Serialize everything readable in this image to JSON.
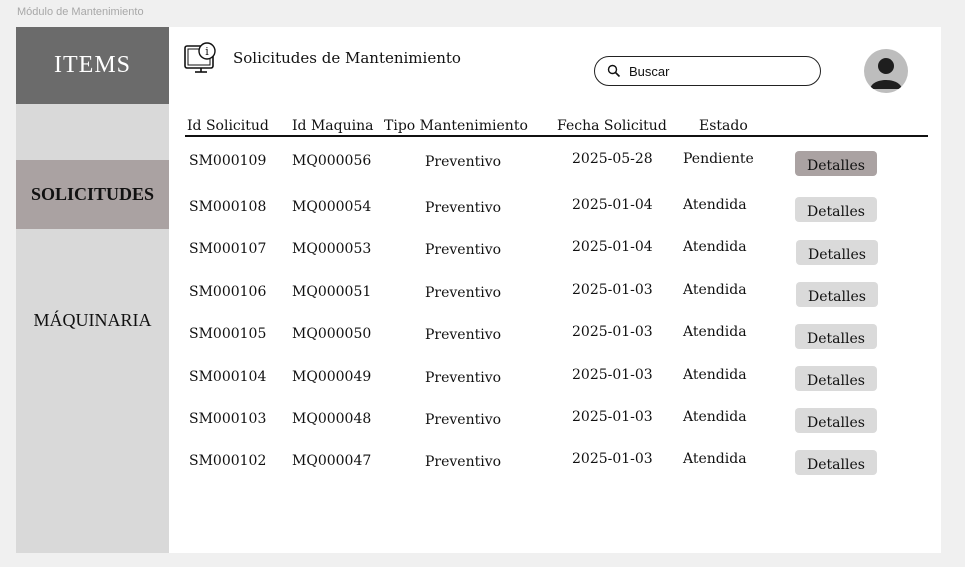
{
  "frame_label": "Módulo de Mantenimiento",
  "sidebar": {
    "logo": "ITEMS",
    "items": [
      {
        "label": "SOLICITUDES",
        "active": true
      },
      {
        "label": "MÁQUINARIA",
        "active": false
      }
    ]
  },
  "header": {
    "title": "Solicitudes de Mantenimiento",
    "title_icon": "computer-info-icon",
    "search_placeholder": "Buscar",
    "avatar_icon": "user-avatar-icon"
  },
  "table": {
    "columns": [
      "Id Solicitud",
      "Id Maquina",
      "Tipo Mantenimiento",
      "Fecha Solicitud",
      "Estado"
    ],
    "action_label": "Detalles",
    "rows": [
      {
        "id": "SM000109",
        "maquina": "MQ000056",
        "tipo": "Preventivo",
        "fecha": "2025-05-28",
        "estado": "Pendiente"
      },
      {
        "id": "SM000108",
        "maquina": "MQ000054",
        "tipo": "Preventivo",
        "fecha": "2025-01-04",
        "estado": "Atendida"
      },
      {
        "id": "SM000107",
        "maquina": "MQ000053",
        "tipo": "Preventivo",
        "fecha": "2025-01-04",
        "estado": "Atendida"
      },
      {
        "id": "SM000106",
        "maquina": "MQ000051",
        "tipo": "Preventivo",
        "fecha": "2025-01-03",
        "estado": "Atendida"
      },
      {
        "id": "SM000105",
        "maquina": "MQ000050",
        "tipo": "Preventivo",
        "fecha": "2025-01-03",
        "estado": "Atendida"
      },
      {
        "id": "SM000104",
        "maquina": "MQ000049",
        "tipo": "Preventivo",
        "fecha": "2025-01-03",
        "estado": "Atendida"
      },
      {
        "id": "SM000103",
        "maquina": "MQ000048",
        "tipo": "Preventivo",
        "fecha": "2025-01-03",
        "estado": "Atendida"
      },
      {
        "id": "SM000102",
        "maquina": "MQ000047",
        "tipo": "Preventivo",
        "fecha": "2025-01-03",
        "estado": "Atendida"
      }
    ]
  },
  "colors": {
    "logo_bg": "#6b6b6b",
    "sidebar_bg": "#d9d9d9",
    "active_bg": "#aaa2a2",
    "button_bg": "#dadada"
  }
}
